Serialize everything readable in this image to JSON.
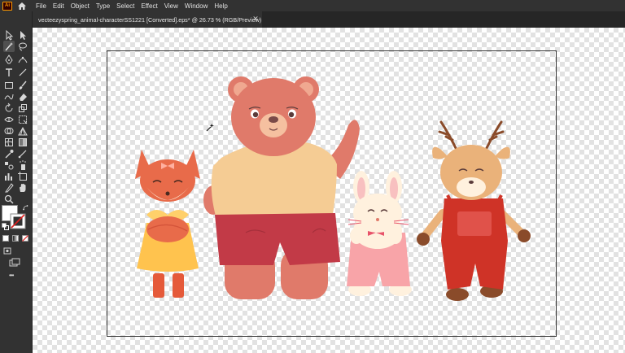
{
  "app": {
    "logo_text": "Ai"
  },
  "menu": {
    "items": [
      "File",
      "Edit",
      "Object",
      "Type",
      "Select",
      "Effect",
      "View",
      "Window",
      "Help"
    ]
  },
  "document": {
    "tab_title": "vecteezyspring_animal-characterSS1221 [Converted].eps* @ 26.73 % (RGB/Preview)",
    "close_glyph": "✕"
  },
  "toolbar": {
    "more_glyph": "•••"
  },
  "colors": {
    "ui_bg": "#323232",
    "tab_bg": "#262626",
    "bear": "#e07a6a",
    "bear_shirt": "#f5cc94",
    "bear_shorts": "#c23a47",
    "fox": "#e86b4a",
    "fox_dress": "#ffc34e",
    "bunny": "#fff1de",
    "bunny_overalls": "#f8a4a8",
    "deer": "#eab27a",
    "deer_overalls": "#cf3327"
  }
}
